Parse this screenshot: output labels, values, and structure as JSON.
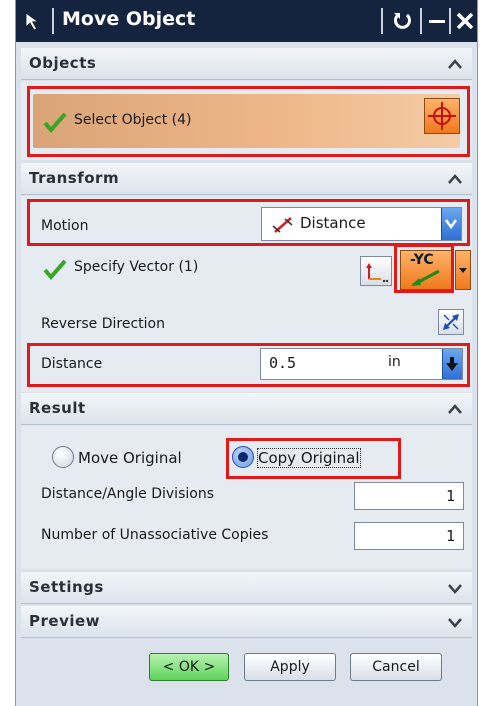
{
  "window": {
    "title": "Move Object"
  },
  "sections": {
    "objects": {
      "title": "Objects",
      "select_label": "Select Object (4)"
    },
    "transform": {
      "title": "Transform",
      "motion_label": "Motion",
      "motion_value": "Distance",
      "specify_vector_label": "Specify Vector (1)",
      "vector_button_label": "-YC",
      "reverse_label": "Reverse Direction",
      "distance_label": "Distance",
      "distance_value": "0.5",
      "distance_unit": "in"
    },
    "result": {
      "title": "Result",
      "move_original_label": "Move Original",
      "copy_original_label": "Copy Original",
      "selected_option": "Copy Original",
      "divisions_label": "Distance/Angle Divisions",
      "divisions_value": "1",
      "copies_label": "Number of Unassociative Copies",
      "copies_value": "1"
    },
    "settings": {
      "title": "Settings"
    },
    "preview": {
      "title": "Preview"
    }
  },
  "buttons": {
    "ok": "< OK >",
    "apply": "Apply",
    "cancel": "Cancel"
  },
  "colors": {
    "titlebar": "#14243f",
    "highlight": "#e01a1a",
    "select_row": "#efb889",
    "ok_button": "#5fd35a"
  },
  "icons": {
    "title": "move-arrow-icon",
    "reset": "reset-icon",
    "minimize": "minimize-icon",
    "close": "close-icon",
    "check": "check-icon",
    "crosshair": "crosshair-icon",
    "distance": "distance-icon",
    "inferred_vector": "inferred-vector-icon",
    "vector": "vector-yc-icon",
    "reverse": "reverse-direction-icon",
    "collapse": "chevron-up-icon",
    "expand": "chevron-down-icon"
  }
}
